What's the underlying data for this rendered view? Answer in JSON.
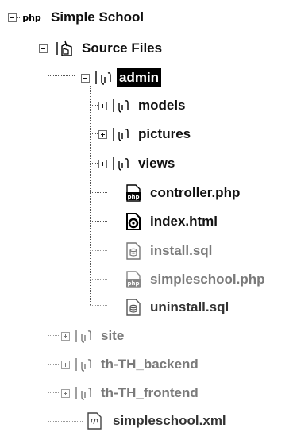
{
  "project": {
    "label": "Simple School",
    "icon": "php-project-icon",
    "expanded": true
  },
  "source_files": {
    "label": "Source Files",
    "icon": "source-folder-icon",
    "expanded": true
  },
  "admin": {
    "label": "admin",
    "icon": "package-folder-icon",
    "expanded": true,
    "selected": true,
    "children": [
      {
        "label": "models",
        "icon": "package-folder-icon",
        "expandable": true
      },
      {
        "label": "pictures",
        "icon": "package-folder-icon",
        "expandable": true
      },
      {
        "label": "views",
        "icon": "package-folder-icon",
        "expandable": true
      },
      {
        "label": "controller.php",
        "icon": "php-file-icon",
        "expandable": false
      },
      {
        "label": "index.html",
        "icon": "html-file-icon",
        "expandable": false
      },
      {
        "label": "install.sql",
        "icon": "sql-file-icon",
        "expandable": false
      },
      {
        "label": "simpleschool.php",
        "icon": "php-file-icon",
        "expandable": false
      },
      {
        "label": "uninstall.sql",
        "icon": "sql-file-icon",
        "expandable": false
      }
    ]
  },
  "source_children": [
    {
      "label": "site",
      "icon": "package-folder-icon",
      "expandable": true
    },
    {
      "label": "th-TH_backend",
      "icon": "package-folder-icon",
      "expandable": true
    },
    {
      "label": "th-TH_frontend",
      "icon": "package-folder-icon",
      "expandable": true
    },
    {
      "label": "simpleschool.xml",
      "icon": "xml-file-icon",
      "expandable": false
    }
  ],
  "colors": {
    "selection_bg": "#000000",
    "selection_text": "#ffffff",
    "text": "#111111",
    "dimmed_text": "#7a7a7a"
  }
}
